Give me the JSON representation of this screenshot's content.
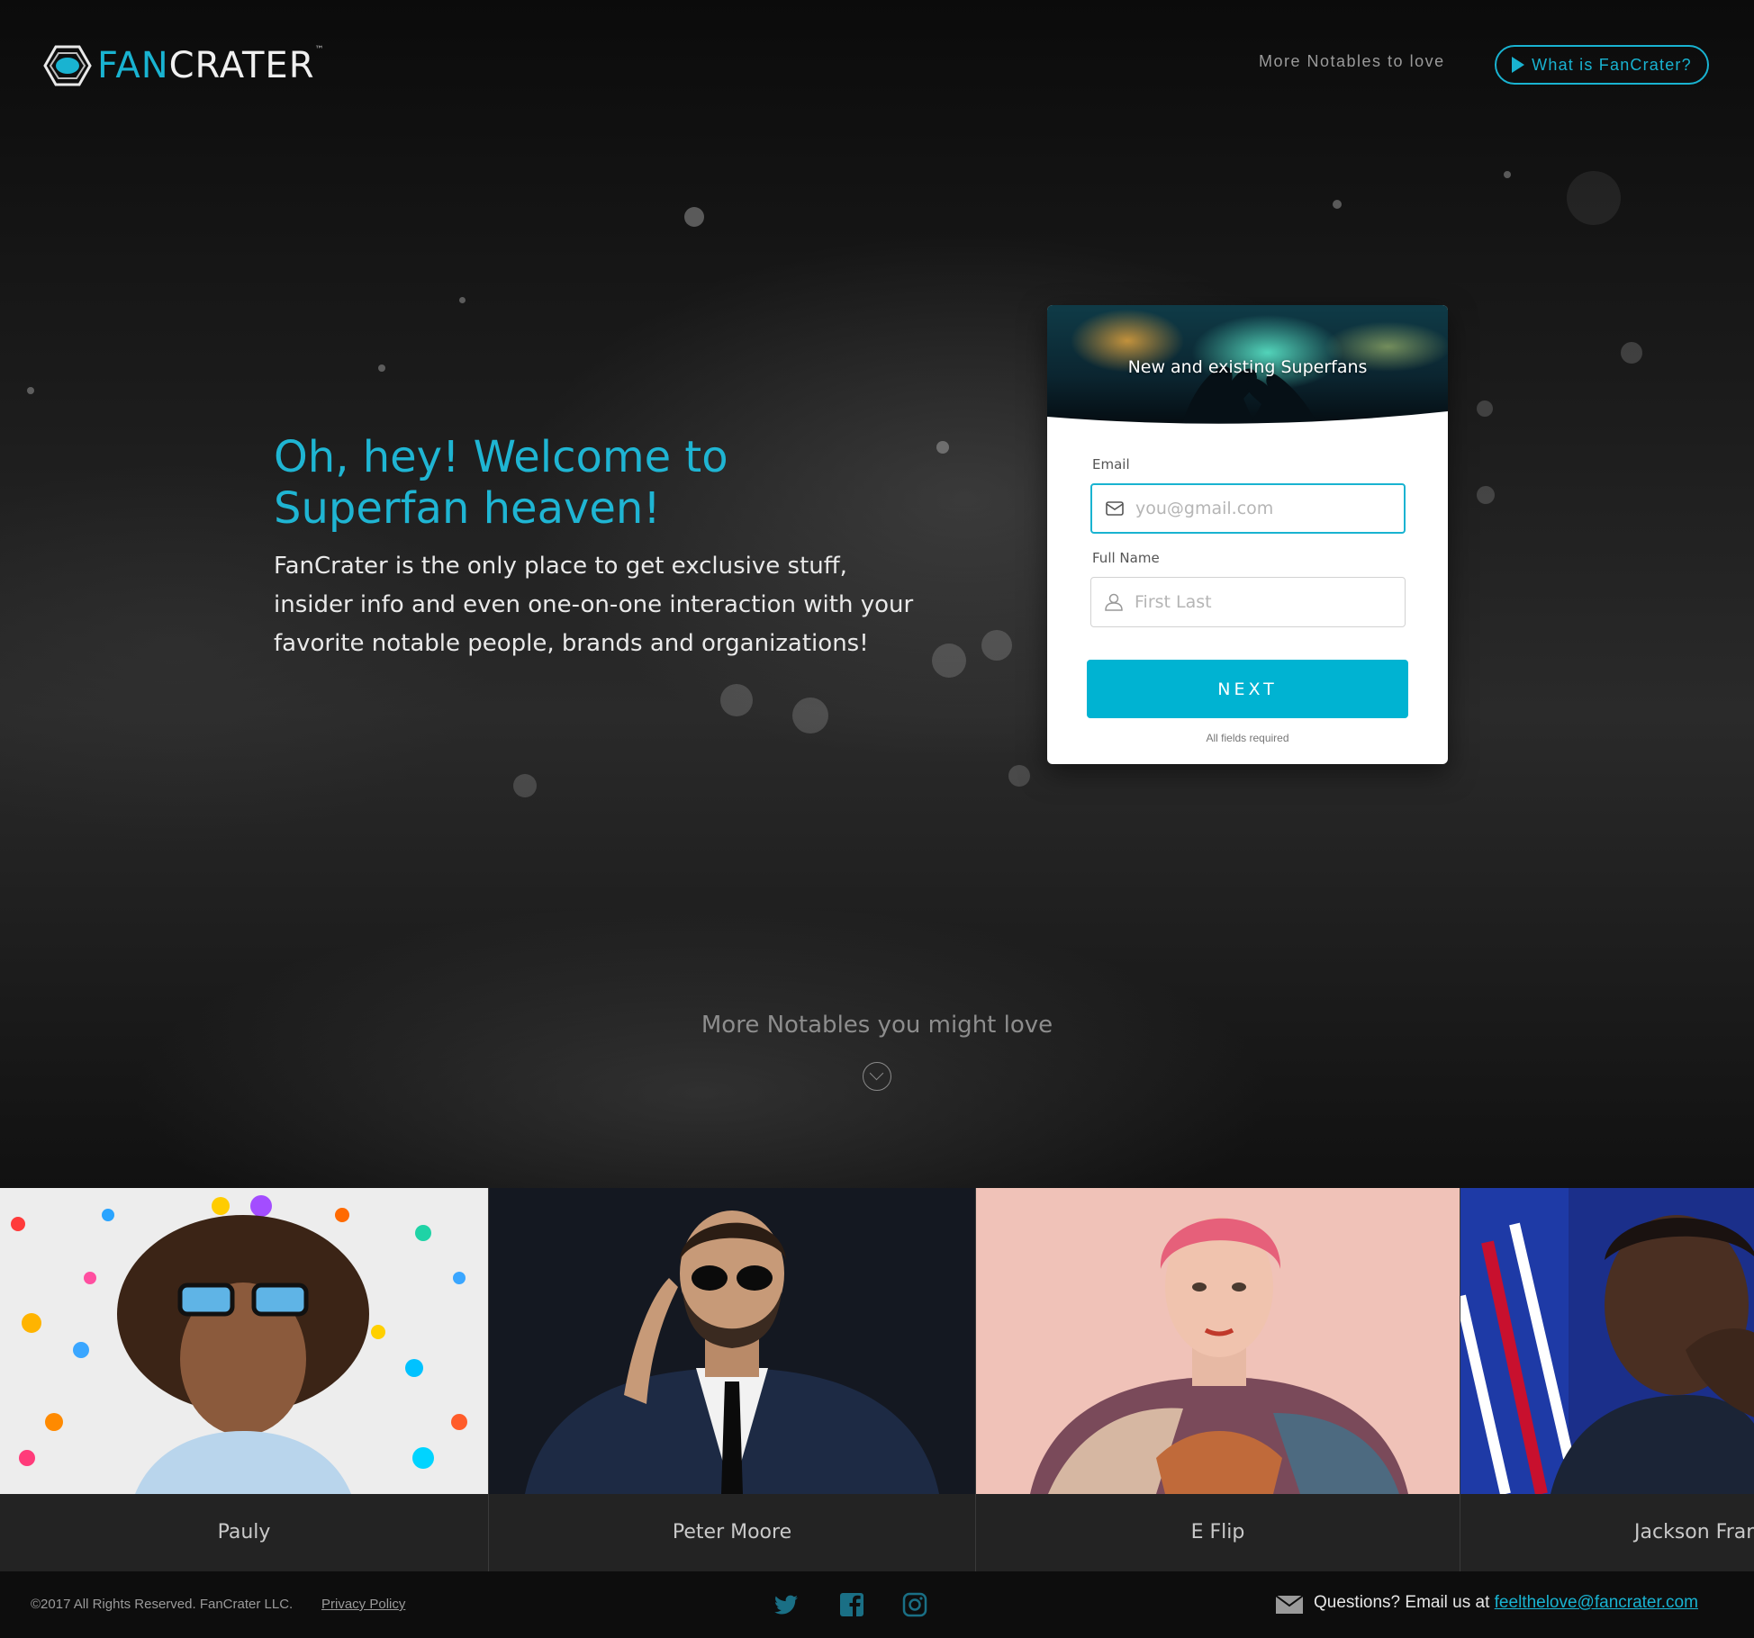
{
  "header": {
    "logo_fan": "FAN",
    "logo_crater": "CRATER",
    "logo_tm": "™",
    "nav_link": "More Notables to love",
    "what_button": "What is FanCrater?"
  },
  "hero": {
    "headline": "Oh, hey! Welcome to Superfan heaven!",
    "subtext": "FanCrater is the only place to get exclusive stuff, insider info and even one-on-one interaction with your favorite notable people, brands and organizations!"
  },
  "signup": {
    "banner_title": "New and existing Superfans",
    "email_label": "Email",
    "email_placeholder": "you@gmail.com",
    "email_value": "",
    "name_label": "Full Name",
    "name_placeholder": "First Last",
    "name_value": "",
    "next_button": "NEXT",
    "required_note": "All fields required"
  },
  "more_section": {
    "title": "More Notables you might love"
  },
  "notables": [
    {
      "name": "Pauly"
    },
    {
      "name": "Peter Moore"
    },
    {
      "name": "E Flip"
    },
    {
      "name": "Jackson Fran"
    }
  ],
  "footer": {
    "copyright": "©2017 All Rights Reserved. FanCrater LLC.",
    "privacy": "Privacy Policy",
    "questions_prefix": "Questions? Email us at ",
    "email": "feelthelove@fancrater.com"
  },
  "colors": {
    "accent": "#19b3d1",
    "button": "#00b3d2",
    "background": "#0e0e0e"
  }
}
